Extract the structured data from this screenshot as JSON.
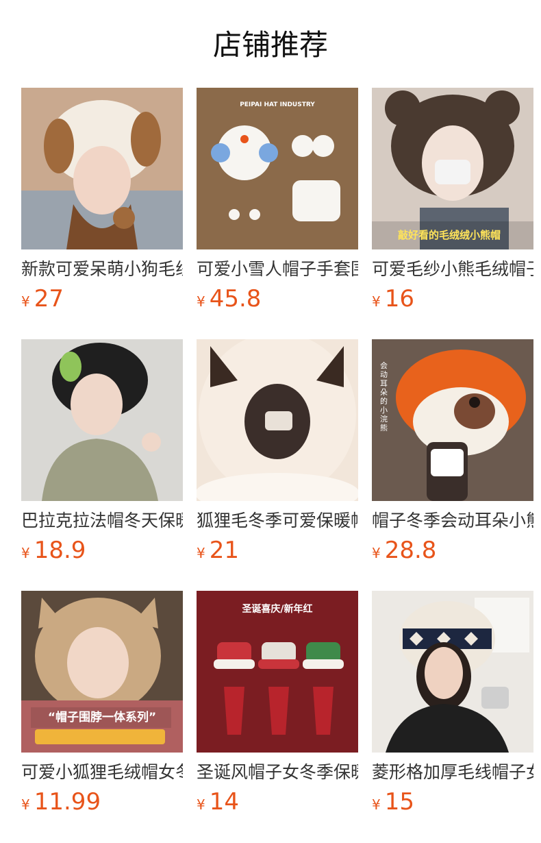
{
  "header": {
    "title": "店铺推荐"
  },
  "currency": "¥",
  "products": [
    {
      "name": "新款可爱呆萌小狗毛线帽",
      "price": "27",
      "image_text": ""
    },
    {
      "name": "可爱小雪人帽子手套围巾",
      "price": "45.8",
      "image_text": "PEIPAI HAT INDUSTRY"
    },
    {
      "name": "可爱毛纱小熊毛绒帽子",
      "price": "16",
      "image_text": "敲好看的毛绒绒小熊帽"
    },
    {
      "name": "巴拉克拉法帽冬天保暖",
      "price": "18.9",
      "image_text": ""
    },
    {
      "name": "狐狸毛冬季可爱保暖帽",
      "price": "21",
      "image_text": ""
    },
    {
      "name": "帽子冬季会动耳朵小熊",
      "price": "28.8",
      "image_text": "会动耳朵的小浣熊"
    },
    {
      "name": "可爱小狐狸毛绒帽女冬",
      "price": "11.99",
      "image_text": "“帽子围脖一体系列”"
    },
    {
      "name": "圣诞风帽子女冬季保暖",
      "price": "14",
      "image_text": "圣诞喜庆/新年红"
    },
    {
      "name": "菱形格加厚毛线帽子女",
      "price": "15",
      "image_text": ""
    }
  ],
  "colors": {
    "price": "#e8541a",
    "title": "#111111",
    "name": "#333333"
  }
}
